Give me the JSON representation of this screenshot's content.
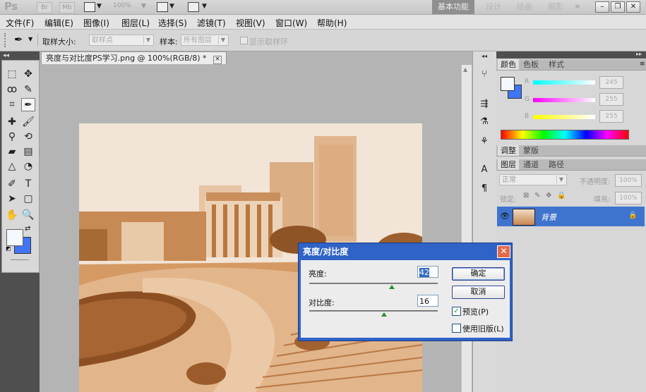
{
  "app": {
    "logo": "Ps",
    "mini_btn_1": "Br",
    "mini_btn_2": "Mb",
    "zoom": "100%",
    "workspaces": [
      "基本功能",
      "设计",
      "绘画",
      "摄影"
    ],
    "more": "»"
  },
  "menubar": [
    "文件(F)",
    "编辑(E)",
    "图像(I)",
    "图层(L)",
    "选择(S)",
    "滤镜(T)",
    "视图(V)",
    "窗口(W)",
    "帮助(H)"
  ],
  "options": {
    "sample_size_label": "取样大小:",
    "sample_size_value": "取样点",
    "sample_label": "样本:",
    "sample_value": "所有图层",
    "show_ring_label": "显示取样环"
  },
  "document": {
    "tab_title": "亮度与对比度PS学习.png @ 100%(RGB/8) *",
    "close": "×"
  },
  "color_panel": {
    "tabs": [
      "颜色",
      "色板",
      "样式"
    ],
    "channels": [
      {
        "label": "R",
        "value": "245"
      },
      {
        "label": "G",
        "value": "255"
      },
      {
        "label": "B",
        "value": "255"
      }
    ]
  },
  "adjust_panel": {
    "tabs": [
      "调整",
      "蒙版"
    ]
  },
  "layers_panel": {
    "tabs": [
      "图层",
      "通道",
      "路径"
    ],
    "blend_mode": "正常",
    "opacity_label": "不透明度:",
    "opacity_value": "100%",
    "lock_label": "锁定:",
    "fill_label": "填充:",
    "fill_value": "100%",
    "layer_name": "背景"
  },
  "dialog": {
    "title": "亮度/对比度",
    "brightness_label": "亮度:",
    "brightness_value": "42",
    "contrast_label": "对比度:",
    "contrast_value": "16",
    "ok_label": "确定",
    "cancel_label": "取消",
    "preview_label": "预览(P)",
    "preview_checked": true,
    "legacy_label": "使用旧版(L)",
    "legacy_checked": false
  },
  "colors": {
    "foreground": "#f4f8ff",
    "background": "#3f75f6",
    "dialog_title": "#2f63c7",
    "selected_layer": "#3f74ce"
  }
}
